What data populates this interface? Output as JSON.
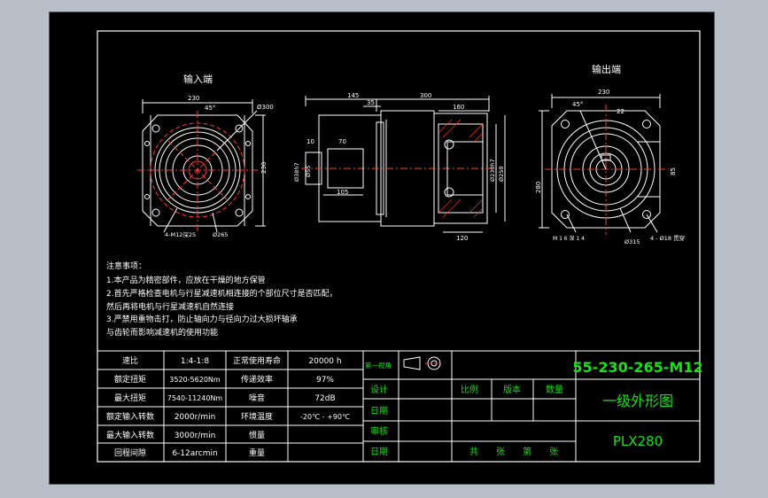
{
  "views": {
    "input_title": "输入端",
    "output_title": "输出端"
  },
  "dims": {
    "in_width": "230",
    "in_angle": "45°",
    "in_circle": "Ø300",
    "in_height": "230",
    "in_holes": "4-M12深25",
    "in_pcd": "Ø265",
    "side_145": "145",
    "side_300": "300",
    "side_35": "35",
    "side_160": "160",
    "side_10": "10",
    "side_70": "70",
    "side_shaft1": "Ø38h7",
    "side_shaft2": "Ø55",
    "side_105": "105",
    "side_pilot1": "Ø230h7",
    "side_pilot2": "Ø250",
    "side_120": "120",
    "out_width": "230",
    "out_angle": "45°",
    "out_22": "22",
    "out_85": "85",
    "out_height": "280",
    "out_m": "M 1 6 深 1 4",
    "out_pcd": "Ø315",
    "out_holes": "4 - Ø18 贯穿"
  },
  "notes": {
    "title": "注意事项：",
    "lines": [
      "1.本产品为精密部件，应放在干燥的地方保管",
      "2.首先严格检查电机与行星减速机相连接的个部位尺寸是否匹配，",
      "然后再将电机与行星减速机自然连接",
      "3.严禁用重物击打，防止轴向力与径向力过大损坏轴承",
      "与齿轮而影响减速机的使用功能"
    ]
  },
  "specs": [
    [
      "速比",
      "1:4-1:8",
      "正常使用寿命",
      "20000 h"
    ],
    [
      "额定扭矩",
      "3520-5620Nm",
      "传递效率",
      "97%"
    ],
    [
      "最大扭矩",
      "7540-11240Nm",
      "噪音",
      "72dB"
    ],
    [
      "额定输入转数",
      "2000r/min",
      "环境温度",
      "-20℃ - +90℃"
    ],
    [
      "最大输入转数",
      "3000r/min",
      "惯量",
      ""
    ],
    [
      "回程间隙",
      "6-12arcmin",
      "重量",
      ""
    ]
  ],
  "titleblock": {
    "projection": "第一视角",
    "model_code": "55-230-265-M12",
    "design": "设计",
    "scale": "比例",
    "version": "版本",
    "quantity": "数量",
    "date1": "日期",
    "drawing_name": "一级外形图",
    "review": "审核",
    "part_no": "PLX280",
    "date2": "日期",
    "sheets": "共　　张　　第　　张"
  }
}
